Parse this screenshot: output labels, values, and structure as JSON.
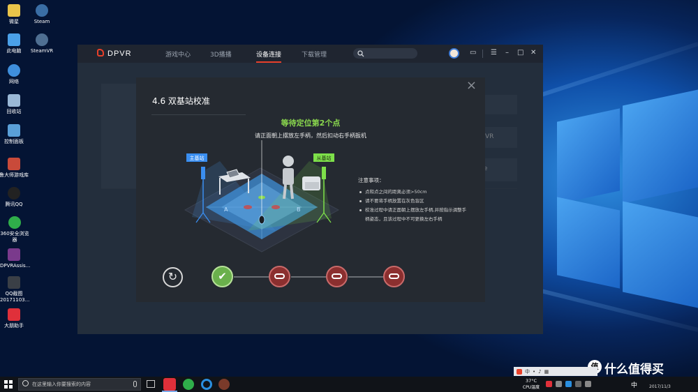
{
  "desktop": {
    "icons": [
      {
        "label": "微星",
        "color": "#e9c44a"
      },
      {
        "label": "Steam",
        "color": "#3a6ea5"
      },
      {
        "label": "此电脑",
        "color": "#4aa0e8"
      },
      {
        "label": "SteamVR",
        "color": "#4f6f92"
      },
      {
        "label": "网络",
        "color": "#3f8fdc"
      },
      {
        "label": "回收站",
        "color": "#9ab8d6"
      },
      {
        "label": "控制面板",
        "color": "#5aa0d8"
      },
      {
        "label": "鲁大师游戏库",
        "color": "#c94a3a"
      },
      {
        "label": "腾讯QQ",
        "color": "#222222"
      },
      {
        "label": "360安全浏览器",
        "color": "#2fae4a"
      },
      {
        "label": "DPVRAssis...",
        "color": "#7a3a8c"
      },
      {
        "label": "QQ截图 20171103...",
        "color": "#3a3f46"
      },
      {
        "label": "大朋助手",
        "color": "#e0303a"
      }
    ]
  },
  "app": {
    "brand": "DPVR",
    "tabs": [
      "游戏中心",
      "3D播播",
      "设备连接",
      "下载管理"
    ],
    "active_tab": "设备连接",
    "bg_fragments": [
      "VR",
      "me"
    ]
  },
  "dialog": {
    "title": "4.6 双基站校准",
    "waiting_text": "等待定位第2个点",
    "instruction": "请正面朝上摆放左手柄，然后扣动右手柄扳机",
    "labels": {
      "master": "主基站",
      "slave": "从基站",
      "zone_a": "A",
      "zone_b": "B"
    },
    "notes_title": "注意事项：",
    "notes": [
      "点和点之间的距离必须>50cm",
      "请不要将手柄放置在灰色盲区",
      "校准过程中请正面朝上摆放左手柄,并按指示调整手柄姿态，且该过程中不可更换左右手柄"
    ],
    "steps": [
      "done",
      "pending",
      "pending",
      "pending"
    ]
  },
  "colors": {
    "accent_red": "#e8402a",
    "green": "#8bd94e",
    "step_done": "#6ab04c",
    "step_pending": "#8b2f2f"
  },
  "taskbar": {
    "search_placeholder": "在这里输入你要搜索的内容",
    "tray_temp": "37°C",
    "tray_cpu": "CPU温度",
    "tray_lang": "中",
    "tray_date": "2017/11/3"
  },
  "watermark": "值 什么值得买"
}
